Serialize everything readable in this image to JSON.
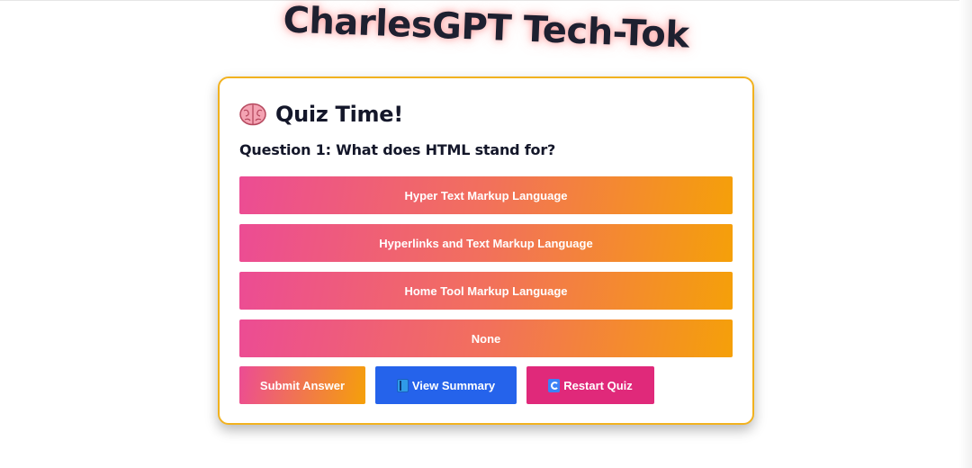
{
  "site": {
    "title": "CharlesGPT Tech-Tok"
  },
  "quiz": {
    "header_icon": "brain-icon",
    "title": "Quiz Time!",
    "question": "Question 1: What does HTML stand for?",
    "options": [
      "Hyper Text Markup Language",
      "Hyperlinks and Text Markup Language",
      "Home Tool Markup Language",
      "None"
    ],
    "actions": {
      "submit_label": "Submit Answer",
      "summary_icon": "book-icon",
      "summary_label": "View Summary",
      "restart_icon": "refresh-icon",
      "restart_label": "Restart Quiz"
    }
  },
  "colors": {
    "gradient_start": "#ec4c94",
    "gradient_end": "#f5a009",
    "summary_blue": "#2563eb",
    "restart_pink": "#e0297a",
    "card_border": "#f2b21f",
    "title_text": "#1e2030"
  }
}
